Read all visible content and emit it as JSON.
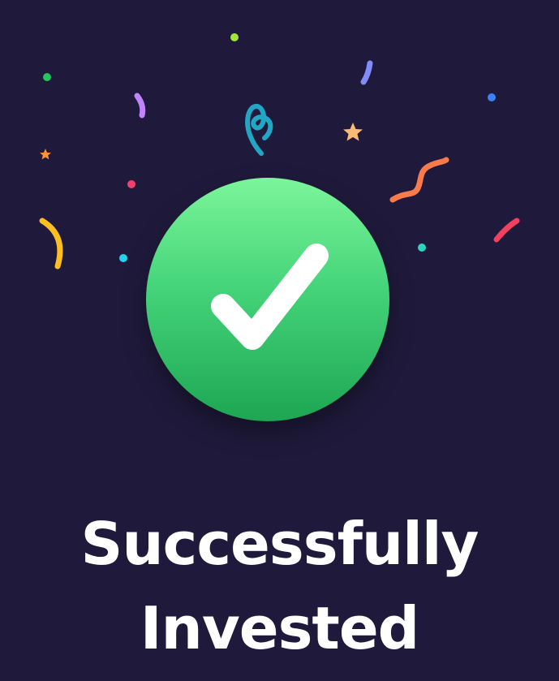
{
  "status": {
    "line1": "Successfully",
    "line2": "Invested",
    "icon": "check-icon"
  },
  "colors": {
    "background": "#1f1a3b",
    "badge_top": "#7cf59a",
    "badge_bottom": "#1ea653",
    "checkmark": "#ffffff"
  }
}
